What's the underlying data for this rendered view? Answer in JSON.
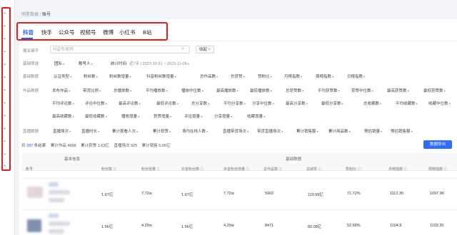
{
  "breadcrumb": {
    "parent": "明星数据",
    "separator": "/",
    "current": "账号"
  },
  "tabs": [
    "抖音",
    "快手",
    "公众号",
    "视频号",
    "微博",
    "小红书",
    "B站"
  ],
  "filters": {
    "search": {
      "label": "搜关键字",
      "placeholder": "抖音号/昵称",
      "button": "收起"
    },
    "basic_filter": {
      "label": "基础筛选",
      "team": "团队",
      "account": "账号人",
      "time_label": "统计时间:",
      "time_range": "近7天 | 2023-10-31 ~ 2023-11-06"
    },
    "basic_data": {
      "label": "基础数据",
      "items": [
        "认证类型",
        "粉丝数",
        "粉丝数增量",
        "抖音粉丝数增量",
        "总作品数",
        "总获赞",
        "赞粉比",
        "月榜指数",
        "周榜指数",
        "日榜指数"
      ]
    },
    "works_data": {
      "label": "作品数据",
      "row1": [
        "发布作品",
        "带货比例",
        "总播放数",
        "平均播放数",
        "播放中位数",
        "最高播放数",
        "最低播放数",
        "总获赞数",
        "平均获赞数",
        "获赞中位数",
        "最高获赞数",
        "最低获赞数"
      ],
      "row2": [
        "平均评论数",
        "评论中位数",
        "最高评论数",
        "最低评论数",
        "总分享数",
        "平均分享数",
        "分享中位数",
        "最高分享数",
        "最低分享数",
        "总收藏数",
        "平均收藏数",
        "收藏中位数"
      ],
      "row3": [
        "最高收藏数",
        "最低收藏数",
        "播放增量",
        "获赞增量",
        "评论增量",
        "分享增量",
        "收藏增量"
      ]
    },
    "live_data": {
      "label": "直播数据",
      "items": [
        "直播场次",
        "直播时长",
        "累计观看人次",
        "累计获赞",
        "场均在线人数",
        "直播带货场次",
        "带货直播场次",
        "累计销售额",
        "累计商品数",
        "预估销量",
        "预估销售额"
      ]
    }
  },
  "stats": {
    "prefix": "共",
    "count": "287",
    "unit": "条结果",
    "works_label": "累计作品",
    "works": "4968",
    "likes_label": "累计获赞",
    "likes": "1.63亿",
    "live_label": "直播场次",
    "live": "925",
    "gmv_label": "累计销售",
    "gmv": "6.65亿"
  },
  "export_button": "数据导出",
  "table": {
    "groups": [
      "基本信息",
      "基础数据"
    ],
    "columns": [
      "账号",
      "粉丝数 ⓘ",
      "粉丝增量 ⓘ",
      "抖音粉丝数 ⓘ",
      "抖音粉丝增量 ⓘ",
      "总作品数 ⓘ",
      "总获赞 ⓘ",
      "赞粉比 ⓘ",
      "月榜指数 ⓘ",
      "周榜指数 ⓘ"
    ],
    "rows": [
      {
        "fans": "1.67亿",
        "fans_inc": "7.72w",
        "dy_fans": "1.67亿",
        "dy_inc": "7.72w",
        "works": "5902",
        "likes": "119.99亿",
        "ratio": "71.72%",
        "monthly": "1112.35",
        "weekly": "1097.96"
      },
      {
        "fans": "1.56亿",
        "fans_inc": "4.29w",
        "dy_fans": "1.56亿",
        "dy_inc": "4.29w",
        "works": "8471",
        "likes": "82.08亿",
        "ratio": "52.68%",
        "monthly": "1104.9",
        "weekly": "1103.35"
      }
    ]
  },
  "colors": {
    "accent": "#1a5fff",
    "highlight": "#e02020"
  }
}
